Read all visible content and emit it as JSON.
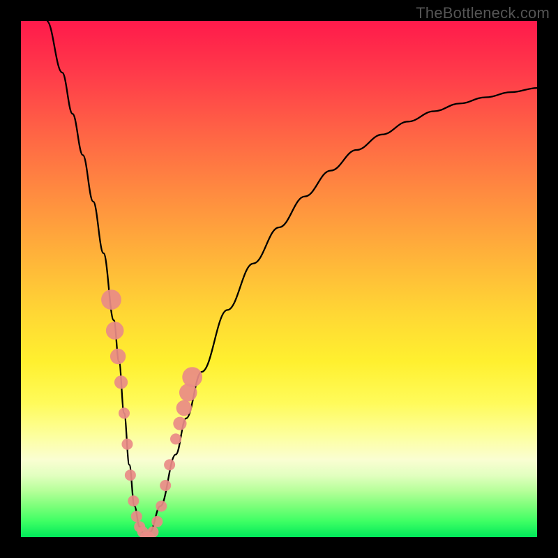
{
  "watermark": "TheBottleneck.com",
  "chart_data": {
    "type": "line",
    "title": "",
    "xlabel": "",
    "ylabel": "",
    "xlim": [
      0,
      100
    ],
    "ylim": [
      0,
      100
    ],
    "grid": false,
    "legend": false,
    "series": [
      {
        "name": "bottleneck-curve",
        "color": "#000000",
        "x": [
          5,
          8,
          10,
          12,
          14,
          16,
          18,
          19,
          20,
          21,
          22,
          23,
          24,
          25,
          27,
          30,
          32,
          35,
          40,
          45,
          50,
          55,
          60,
          65,
          70,
          75,
          80,
          85,
          90,
          95,
          100
        ],
        "y": [
          100,
          90,
          82,
          74,
          65,
          55,
          42,
          34,
          24,
          14,
          6,
          2,
          0,
          1,
          6,
          16,
          23,
          32,
          44,
          53,
          60,
          66,
          71,
          75,
          78,
          80.5,
          82.5,
          84,
          85.2,
          86.2,
          87
        ]
      },
      {
        "name": "highlight-dots",
        "color": "#e98b87",
        "type": "scatter",
        "x": [
          17.5,
          18.2,
          18.8,
          19.4,
          20.0,
          20.6,
          21.2,
          21.8,
          22.4,
          23.0,
          23.6,
          24.2,
          24.8,
          25.6,
          26.4,
          27.2,
          28.0,
          28.8,
          30.0,
          30.8,
          31.6,
          32.4,
          33.2
        ],
        "y": [
          46,
          40,
          35,
          30,
          24,
          18,
          12,
          7,
          4,
          2,
          1,
          0,
          0,
          1,
          3,
          6,
          10,
          14,
          19,
          22,
          25,
          28,
          31
        ]
      }
    ],
    "background_gradient": {
      "top": "#ff1a4b",
      "mid": "#ffd834",
      "bottom": "#00e95a"
    }
  }
}
